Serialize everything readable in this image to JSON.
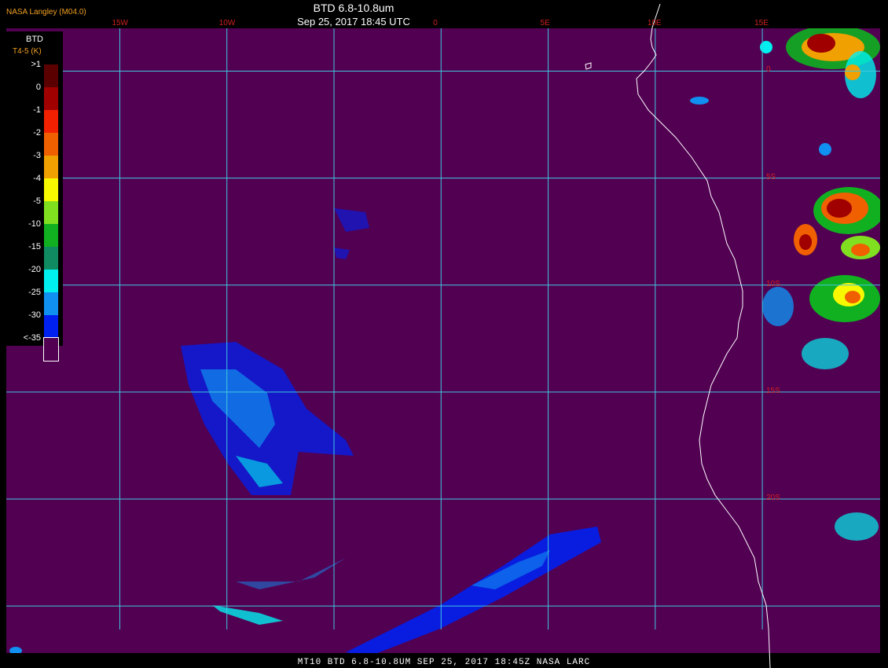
{
  "header": {
    "organization": "NASA Langley (M04.0)",
    "product_title": "BTD 6.8-10.8um",
    "datetime": "Sep 25, 2017 18:45 UTC"
  },
  "footer": {
    "caption": "MT10  BTD 6.8-10.8UM  SEP 25, 2017 18:45Z  NASA LARC"
  },
  "legend": {
    "title": "BTD",
    "unit": "T4-5 (K)",
    "bins": [
      {
        "label": ">1",
        "color": "#5a0000"
      },
      {
        "label": "0",
        "color": "#a00000"
      },
      {
        "label": "-1",
        "color": "#f02000"
      },
      {
        "label": "-2",
        "color": "#f06000"
      },
      {
        "label": "-3",
        "color": "#f0a000"
      },
      {
        "label": "-4",
        "color": "#f8f800"
      },
      {
        "label": "-5",
        "color": "#80e020"
      },
      {
        "label": "-10",
        "color": "#10b020"
      },
      {
        "label": "-15",
        "color": "#108a60"
      },
      {
        "label": "-20",
        "color": "#00f0f0"
      },
      {
        "label": "-25",
        "color": "#1090f0"
      },
      {
        "label": "-30",
        "color": "#0020f0"
      },
      {
        "label": "<-35",
        "color": "#520052"
      }
    ]
  },
  "grid": {
    "lon_labels": [
      {
        "label": "15W",
        "lon": -15
      },
      {
        "label": "10W",
        "lon": -10
      },
      {
        "label": "0",
        "lon": 0
      },
      {
        "label": "5E",
        "lon": 5
      },
      {
        "label": "10E",
        "lon": 10
      },
      {
        "label": "15E",
        "lon": 15
      }
    ],
    "lat_labels": [
      {
        "label": "0",
        "lat": 0
      },
      {
        "label": "5S",
        "lat": -5
      },
      {
        "label": "10S",
        "lat": -10
      },
      {
        "label": "15S",
        "lat": -15
      },
      {
        "label": "20S",
        "lat": -20
      }
    ],
    "lon_lines": [
      -15,
      -10,
      -5,
      0,
      5,
      10,
      15
    ],
    "lat_lines": [
      0,
      -5,
      -10,
      -15,
      -20,
      -25
    ],
    "bounds": {
      "lon_min": -20.3,
      "lon_max": 20.5,
      "lat_max": 2.0,
      "lat_min": -27.2
    }
  },
  "colors": {
    "background": "#520052",
    "gridline": "#40c8e0",
    "coastline": "#ffffff",
    "axis_label": "#d02020"
  }
}
